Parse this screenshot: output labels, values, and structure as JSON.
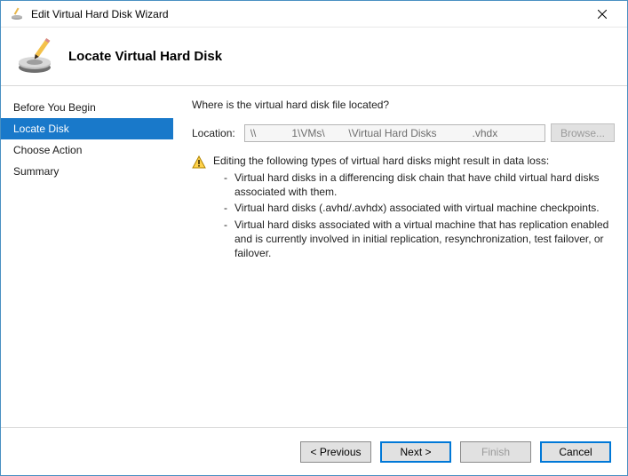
{
  "window": {
    "title": "Edit Virtual Hard Disk Wizard"
  },
  "header": {
    "title": "Locate Virtual Hard Disk"
  },
  "sidebar": {
    "items": [
      {
        "label": "Before You Begin"
      },
      {
        "label": "Locate Disk"
      },
      {
        "label": "Choose Action"
      },
      {
        "label": "Summary"
      }
    ],
    "selected_index": 1
  },
  "content": {
    "question": "Where is the virtual hard disk file located?",
    "location_label": "Location:",
    "location_value": "\\\\            1\\VMs\\        \\Virtual Hard Disks            .vhdx",
    "browse_label": "Browse...",
    "warning": {
      "lead": "Editing the following types of virtual hard disks might result in data loss:",
      "bullets": [
        "Virtual hard disks in a differencing disk chain that have child virtual hard disks associated with them.",
        "Virtual hard disks (.avhd/.avhdx) associated with virtual machine checkpoints.",
        "Virtual hard disks associated with a virtual machine that has replication enabled and is currently involved in initial replication, resynchronization, test failover, or failover."
      ]
    }
  },
  "footer": {
    "previous": "< Previous",
    "next": "Next >",
    "finish": "Finish",
    "cancel": "Cancel"
  }
}
